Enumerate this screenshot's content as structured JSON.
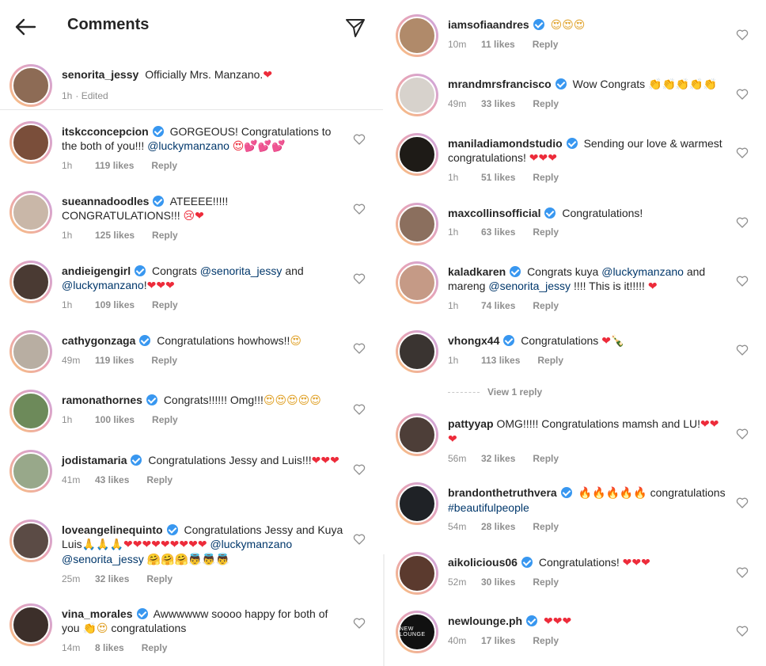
{
  "header": {
    "title": "Comments"
  },
  "caption": {
    "username": "senorita_jessy",
    "text": "Officially Mrs. Manzano.",
    "time": "1h",
    "edited": "· Edited"
  },
  "left_comments": [
    {
      "username": "itskcconcepcion",
      "verified": true,
      "text": "GORGEOUS! Congratulations to the both of you!!!",
      "mention": "@luckymanzano",
      "emoji": "😍💕💕💕",
      "time": "1h",
      "likes": "119 likes",
      "reply": "Reply",
      "avatar_color": "#7a4e3a"
    },
    {
      "username": "sueannadoodles",
      "verified": true,
      "text": "ATEEEE!!!!! CONGRATULATIONS!!!",
      "emoji": "😢❤",
      "time": "1h",
      "likes": "125 likes",
      "reply": "Reply",
      "avatar_color": "#c9b7a8"
    },
    {
      "username": "andieigengirl",
      "verified": true,
      "text": "Congrats",
      "mention": "@senorita_jessy",
      "text2": "and",
      "mention2": "@luckymanzano",
      "text3": "!",
      "emoji": "❤❤❤",
      "time": "1h",
      "likes": "109 likes",
      "reply": "Reply",
      "avatar_color": "#4a3a33"
    },
    {
      "username": "cathygonzaga",
      "verified": true,
      "text": "Congratulations howhows!!",
      "emoji": "😍",
      "time": "49m",
      "likes": "119 likes",
      "reply": "Reply",
      "avatar_color": "#b8aea2"
    },
    {
      "username": "ramonathornes",
      "verified": true,
      "text": "Congrats!!!!!! Omg!!!",
      "emoji": "😍😍😍😍😍",
      "time": "1h",
      "likes": "100 likes",
      "reply": "Reply",
      "avatar_color": "#6d8a5a"
    },
    {
      "username": "jodistamaria",
      "verified": true,
      "text": "Congratulations Jessy and Luis!!!",
      "emoji": "❤❤❤",
      "time": "41m",
      "likes": "43 likes",
      "reply": "Reply",
      "avatar_color": "#98a88a"
    },
    {
      "username": "loveangelinequinto",
      "verified": true,
      "text": "Congratulations Jessy and Kuya Luis",
      "emoji": "🙏🙏🙏❤❤❤❤❤❤❤❤❤",
      "mention": "@luckymanzano",
      "mention2": "@senorita_jessy",
      "emoji2": "🤗🤗🤗👼👼👼",
      "time": "25m",
      "likes": "32 likes",
      "reply": "Reply",
      "avatar_color": "#5b4b45"
    },
    {
      "username": "vina_morales",
      "verified": true,
      "text": "Awwwwww soooo happy for both of you",
      "emoji": "👏😍",
      "text2": "congratulations",
      "time": "14m",
      "likes": "8 likes",
      "reply": "Reply",
      "avatar_color": "#3c2f2a"
    }
  ],
  "right_comments": [
    {
      "username": "iamsofiaandres",
      "verified": true,
      "emoji": "😍😍😍",
      "time": "10m",
      "likes": "11 likes",
      "reply": "Reply",
      "avatar_color": "#b08a6a"
    },
    {
      "username": "mrandmrsfrancisco",
      "verified": true,
      "text": "Wow Congrats",
      "emoji": "👏👏👏👏👏",
      "time": "49m",
      "likes": "33 likes",
      "reply": "Reply",
      "avatar_color": "#d7d2cc"
    },
    {
      "username": "maniladiamondstudio",
      "verified": true,
      "text": "Sending our love & warmest congratulations!",
      "emoji": "❤❤❤",
      "time": "1h",
      "likes": "51 likes",
      "reply": "Reply",
      "avatar_color": "#1e1b17"
    },
    {
      "username": "maxcollinsofficial",
      "verified": true,
      "text": "Congratulations!",
      "time": "1h",
      "likes": "63 likes",
      "reply": "Reply",
      "avatar_color": "#8b6f5e"
    },
    {
      "username": "kaladkaren",
      "verified": true,
      "text": "Congrats kuya",
      "mention": "@luckymanzano",
      "text2": "and mareng",
      "mention2": "@senorita_jessy",
      "text3": "!!!! This is it!!!!!",
      "emoji": "❤",
      "time": "1h",
      "likes": "74 likes",
      "reply": "Reply",
      "avatar_color": "#c59a86"
    },
    {
      "username": "vhongx44",
      "verified": true,
      "text": "Congratulations",
      "emoji": "❤🍾",
      "time": "1h",
      "likes": "113 likes",
      "reply": "Reply",
      "avatar_color": "#3a3431",
      "view_reply": "View 1 reply"
    },
    {
      "username": "pattyyap",
      "verified": false,
      "text": "OMG!!!!! Congratulations mamsh and LU!",
      "emoji": "❤❤❤",
      "time": "56m",
      "likes": "32 likes",
      "reply": "Reply",
      "avatar_color": "#4d3e38"
    },
    {
      "username": "brandonthetruthvera",
      "verified": true,
      "emoji": "🔥🔥🔥🔥🔥",
      "text": "congratulations",
      "mention": "#beautifulpeople",
      "time": "54m",
      "likes": "28 likes",
      "reply": "Reply",
      "avatar_color": "#1f2226"
    },
    {
      "username": "aikolicious06",
      "verified": true,
      "text": "Congratulations!",
      "emoji": "❤❤❤",
      "time": "52m",
      "likes": "30 likes",
      "reply": "Reply",
      "avatar_color": "#5b3a2e"
    },
    {
      "username": "newlounge.ph",
      "verified": true,
      "emoji": "❤❤❤",
      "time": "40m",
      "likes": "17 likes",
      "reply": "Reply",
      "avatar_color": "#111111",
      "avatar_text": "NEW LOUNGE"
    }
  ]
}
